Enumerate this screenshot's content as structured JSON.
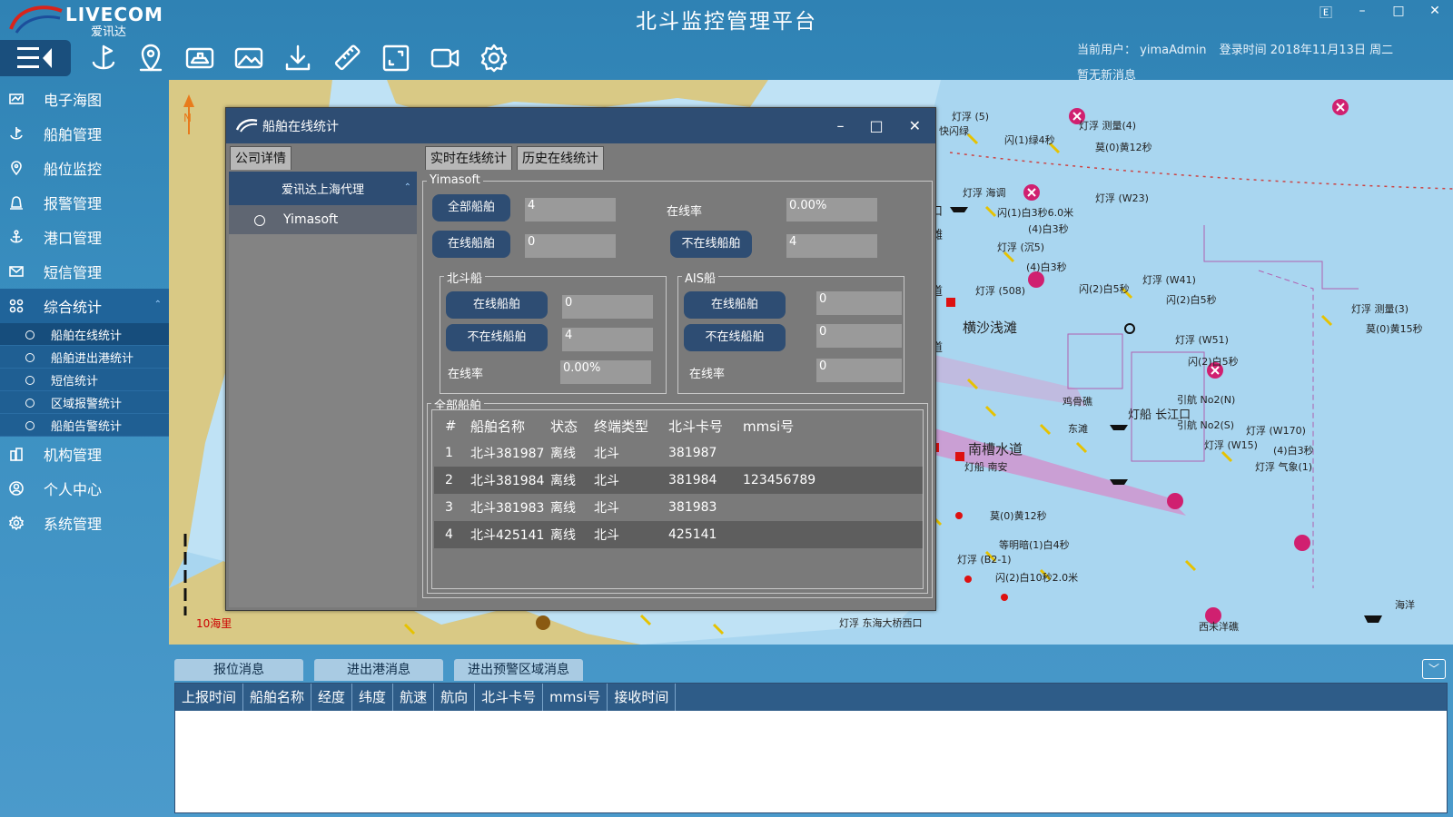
{
  "app": {
    "logo_text": "LIVECOM",
    "logo_sub": "爱讯达",
    "title": "北斗监控管理平台",
    "win_ctrls": [
      "🄴",
      "–",
      "□",
      "✕"
    ]
  },
  "user": {
    "current_user": "当前用户： yimaAdmin",
    "login_time": "登录时间 2018年11月13日 周二",
    "no_message": "暂无新消息"
  },
  "toolbar": {
    "icons": [
      "menu-toggle",
      "ship-anchor-icon",
      "location-pin-icon",
      "ship-image-icon",
      "image-icon",
      "download-icon",
      "ruler-icon",
      "fullscreen-icon",
      "video-icon",
      "settings-icon"
    ]
  },
  "sidebar": {
    "items": [
      {
        "label": "电子海图",
        "icon": "chart-icon"
      },
      {
        "label": "船舶管理",
        "icon": "ship-icon"
      },
      {
        "label": "船位监控",
        "icon": "location-icon"
      },
      {
        "label": "报警管理",
        "icon": "alarm-icon"
      },
      {
        "label": "港口管理",
        "icon": "anchor-icon"
      },
      {
        "label": "短信管理",
        "icon": "mail-icon"
      },
      {
        "label": "综合统计",
        "icon": "grid-icon"
      },
      {
        "label": "机构管理",
        "icon": "building-icon"
      },
      {
        "label": "个人中心",
        "icon": "user-icon"
      },
      {
        "label": "系统管理",
        "icon": "gear-icon"
      }
    ],
    "sub_items": [
      "船舶在线统计",
      "船舶进出港统计",
      "短信统计",
      "区域报警统计",
      "船舶告警统计"
    ]
  },
  "map": {
    "scale_label": "10海里",
    "labels": [
      "灯浮 (5)",
      "灯浮 测量(4)",
      "闪(1)绿4秒",
      "莫(0)黄12秒",
      "快闪绿",
      "灯浮 海调",
      "灯浮 (W23)",
      "闪(1)白3秒6.0米",
      "(4)白3秒",
      "灯浮 (沉5)",
      "(4)白3秒",
      "灯浮 (W41)",
      "闪(2)白5秒",
      "闪(2)白5秒",
      "灯浮 测量(3)",
      "莫(0)黄15秒",
      "灯浮 (508)",
      "横沙浅滩",
      "灯浮 (W51)",
      "闪(2)白5秒",
      "引航 No2(N)",
      "灯船 长江口",
      "引航 No2(S)",
      "灯浮 (W170)",
      "灯浮 (W15)",
      "(4)白3秒",
      "灯浮 气象(1)",
      "南槽水道",
      "灯船 南安",
      "莫(0)黄12秒",
      "等明暗(1)白4秒",
      "灯浮 (B2-1)",
      "闪(2)白10秒2.0米",
      "鸡骨礁",
      "东滩",
      "灯浮 东海大桥西口",
      "西未洋礁",
      "海洋",
      "水道",
      "江口",
      "东滩",
      "水道"
    ]
  },
  "dialog": {
    "title": "船舶在线统计",
    "ctrls": [
      "–",
      "□",
      "✕"
    ],
    "tabs": {
      "company_detail": "公司详情",
      "realtime": "实时在线统计",
      "history": "历史在线统计"
    },
    "company": {
      "name": "爱讯达上海代理",
      "sub": "Yimasoft"
    },
    "summary": {
      "legend": "Yimasoft",
      "all_label": "全部船舶",
      "all_value": "4",
      "rate_label": "在线率",
      "rate_value": "0.00%",
      "online_label": "在线船舶",
      "online_value": "0",
      "offline_label": "不在线船舶",
      "offline_value": "4"
    },
    "beidou": {
      "legend": "北斗船",
      "online_label": "在线船舶",
      "online_value": "0",
      "offline_label": "不在线船舶",
      "offline_value": "4",
      "rate_label": "在线率",
      "rate_value": "0.00%"
    },
    "ais": {
      "legend": "AIS船",
      "online_label": "在线船舶",
      "online_value": "0",
      "offline_label": "不在线船舶",
      "offline_value": "0",
      "rate_label": "在线率",
      "rate_value": "0"
    },
    "table": {
      "legend": "全部船舶",
      "headers": [
        "#",
        "船舶名称",
        "状态",
        "终端类型",
        "北斗卡号",
        "mmsi号"
      ],
      "rows": [
        [
          "1",
          "北斗381987",
          "离线",
          "北斗",
          "381987",
          ""
        ],
        [
          "2",
          "北斗381984",
          "离线",
          "北斗",
          "381984",
          "123456789"
        ],
        [
          "3",
          "北斗381983",
          "离线",
          "北斗",
          "381983",
          ""
        ],
        [
          "4",
          "北斗425141",
          "离线",
          "北斗",
          "425141",
          ""
        ]
      ]
    }
  },
  "bottom": {
    "tabs": [
      "报位消息",
      "进出港消息",
      "进出预警区域消息"
    ],
    "collapse_icon": "﹀",
    "columns": [
      "上报时间",
      "船舶名称",
      "经度",
      "纬度",
      "航速",
      "航向",
      "北斗卡号",
      "mmsi号",
      "接收时间"
    ]
  },
  "colors": {
    "accent": "#2e4d73",
    "background": "#3a8fc0"
  }
}
